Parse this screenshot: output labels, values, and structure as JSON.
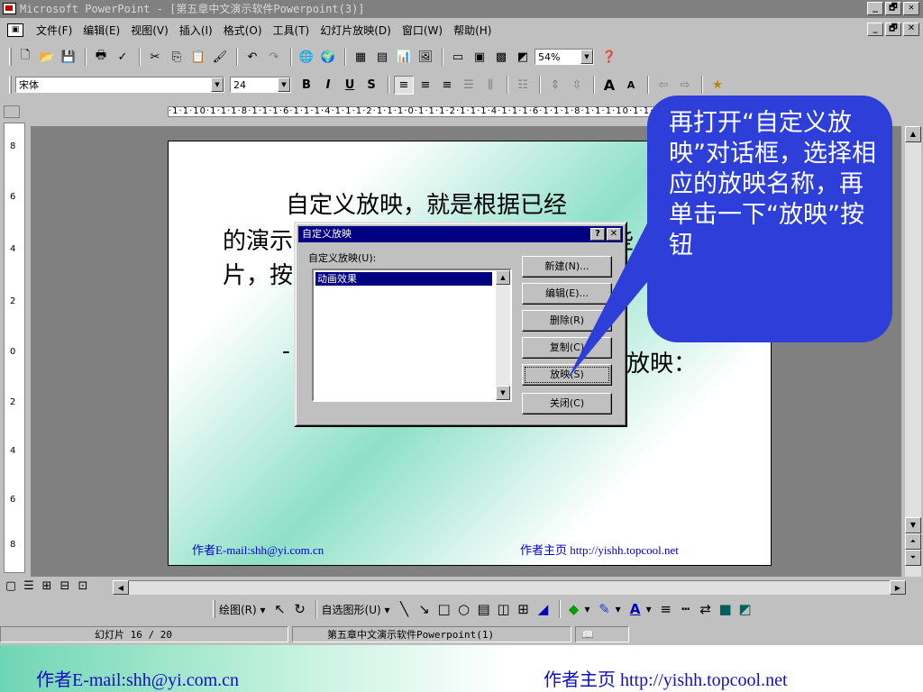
{
  "window": {
    "title": "Microsoft PowerPoint - [第五章中文演示软件Powerpoint(3)]",
    "controls": [
      "_",
      "🗗",
      "✕"
    ]
  },
  "menu": {
    "items": [
      "文件(F)",
      "编辑(E)",
      "视图(V)",
      "插入(I)",
      "格式(O)",
      "工具(T)",
      "幻灯片放映(D)",
      "窗口(W)",
      "帮助(H)"
    ]
  },
  "toolbar": {
    "zoom": "54%"
  },
  "format_bar": {
    "font": "宋体",
    "size": "24",
    "bold": "B",
    "italic": "I",
    "underline": "U",
    "shadow": "S"
  },
  "ruler": {
    "horizontal": "·1·1·10·1·1·1·8·1·1·1·6·1·1·1·4·1·1·1·2·1·1·1·0·1·1·1·2·1·1·1·4·1·1·1·6·1·1·1·8·1·1·1·10·1·1·",
    "vertical": [
      "8",
      "6",
      "4",
      "2",
      "0",
      "2",
      "4",
      "6",
      "8"
    ]
  },
  "slide": {
    "line1": "自定义放映，就是根据已经",
    "line2": "的演示",
    "line2_right": "些",
    "line3": "片，按",
    "line4_left": "-",
    "line4_right": "放映：",
    "footer_left": "作者E-mail:shh@yi.com.cn",
    "footer_right_label": "作者主页",
    "footer_right_url": "http://yishh.topcool.net"
  },
  "dialog": {
    "title": "自定义放映",
    "help": "?",
    "close": "✕",
    "list_label": "自定义放映(U):",
    "list_items": [
      "动画效果"
    ],
    "buttons": {
      "new": "新建(N)...",
      "edit": "编辑(E)...",
      "delete": "删除(R)",
      "copy": "复制(C)",
      "show": "放映(S)",
      "close": "关闭(C)"
    }
  },
  "callout": {
    "text": "再打开“自定义放映”对话框，选择相应的放映名称，再单击一下“放映”按钮"
  },
  "drawing_toolbar": {
    "draw": "绘图(R)",
    "autoshapes": "自选图形(U)"
  },
  "status": {
    "slide_info": "幻灯片 16 / 20",
    "template": "第五章中文演示软件Powerpoint(1)"
  },
  "page_footer": {
    "left": "作者E-mail:shh@yi.com.cn",
    "right_label": "作者主页",
    "right_url": "http://yishh.topcool.net"
  },
  "colors": {
    "dialog_title": "#000080",
    "callout_bg": "#2d3fd8",
    "footer_text": "#1010c0"
  }
}
